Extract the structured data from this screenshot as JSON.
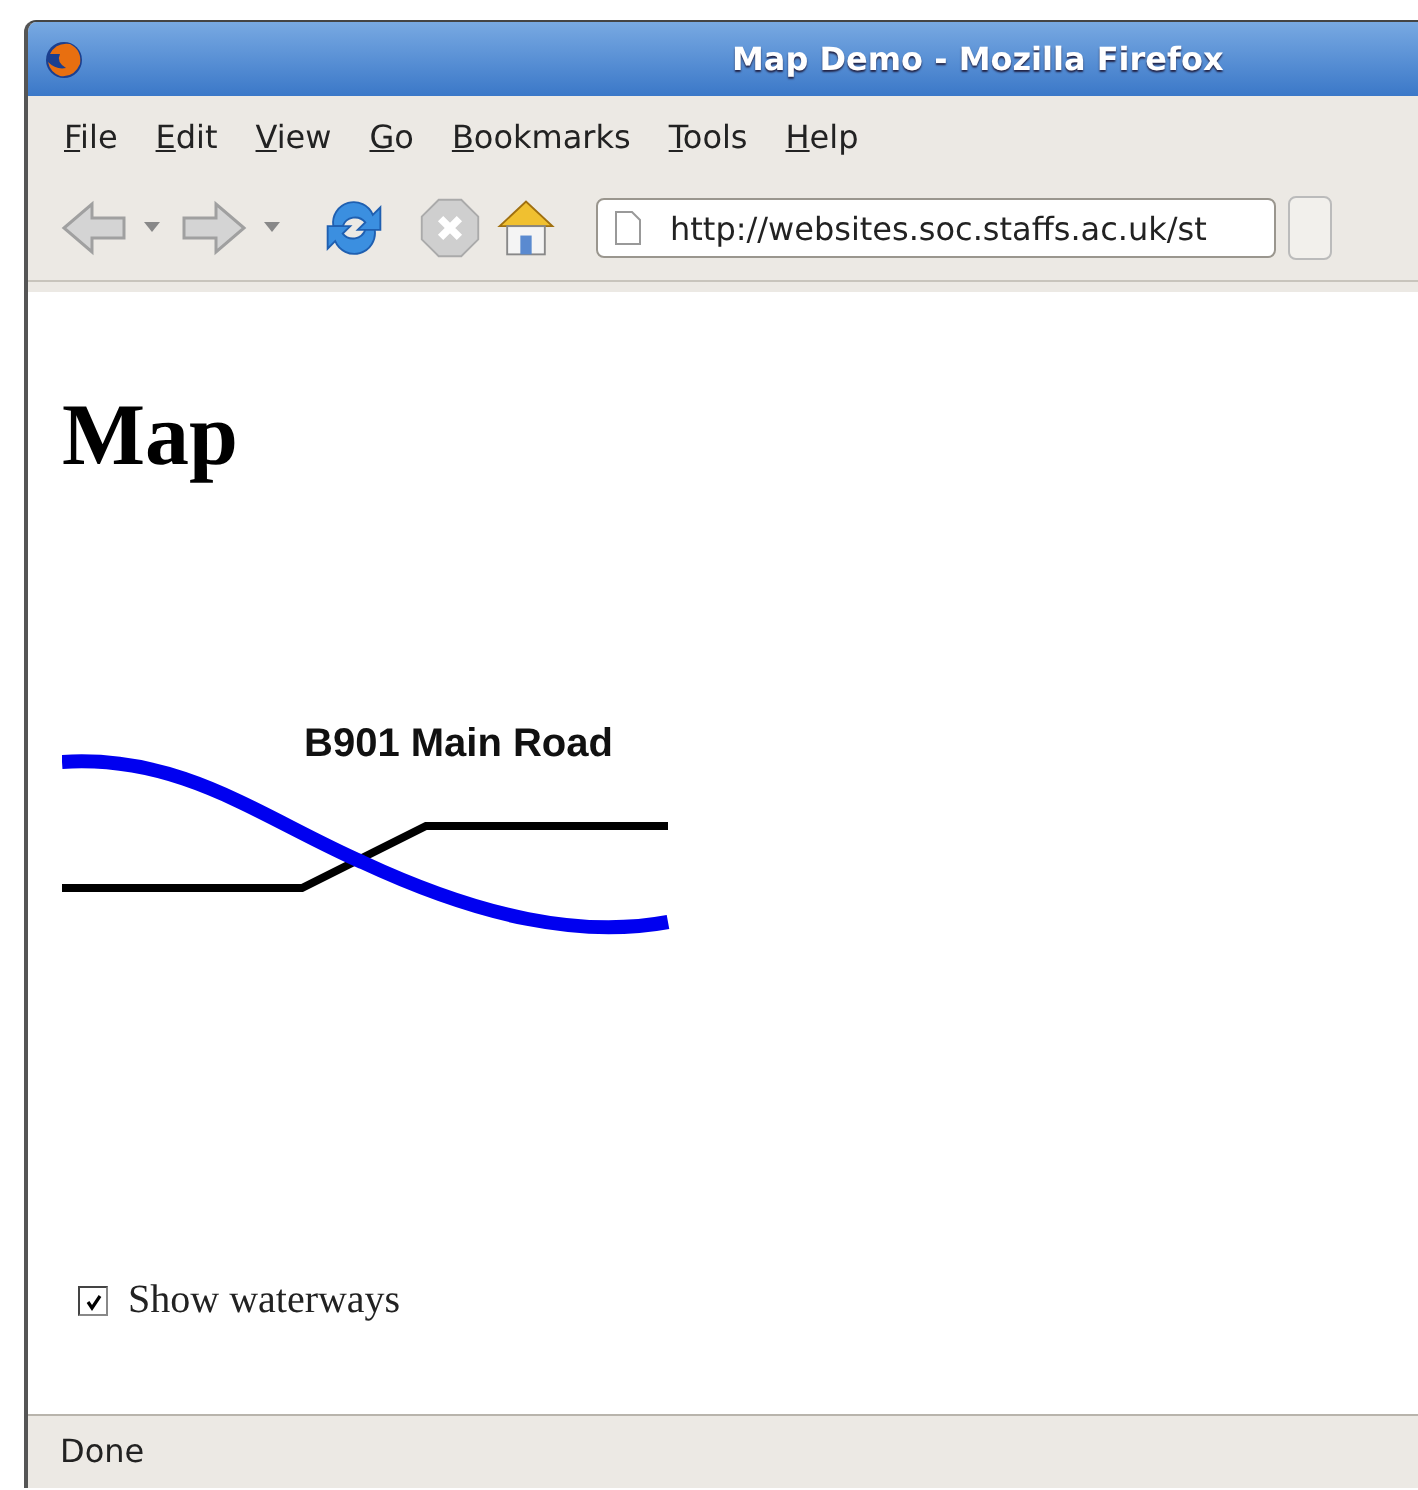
{
  "window": {
    "title": "Map Demo - Mozilla Firefox"
  },
  "menu": [
    "File",
    "Edit",
    "View",
    "Go",
    "Bookmarks",
    "Tools",
    "Help"
  ],
  "address_bar": {
    "value": "http://websites.soc.staffs.ac.uk/st"
  },
  "page": {
    "heading": "Map",
    "map": {
      "road_label": "B901 Main Road"
    },
    "checkbox": {
      "label": "Show waterways",
      "checked": true
    }
  },
  "status_bar": "Done"
}
